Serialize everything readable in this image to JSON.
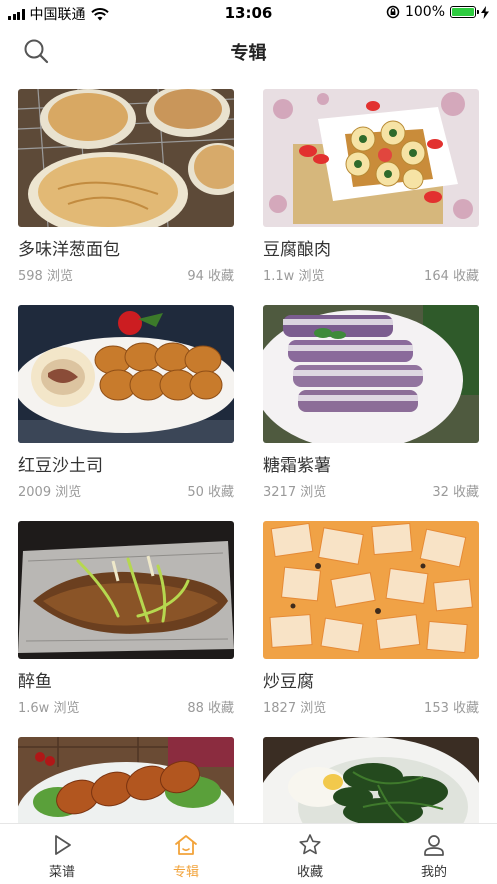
{
  "status_bar": {
    "carrier": "中国联通",
    "time": "13:06",
    "battery": "100%",
    "battery_level": 1.0
  },
  "header": {
    "title": "专辑"
  },
  "albums": [
    {
      "title": "多味洋葱面包",
      "views": "598 浏览",
      "favorites": "94 收藏"
    },
    {
      "title": "豆腐酿肉",
      "views": "1.1w 浏览",
      "favorites": "164 收藏"
    },
    {
      "title": "红豆沙土司",
      "views": "2009 浏览",
      "favorites": "50 收藏"
    },
    {
      "title": "糖霜紫薯",
      "views": "3217 浏览",
      "favorites": "32 收藏"
    },
    {
      "title": "醉鱼",
      "views": "1.6w 浏览",
      "favorites": "88 收藏"
    },
    {
      "title": "炒豆腐",
      "views": "1827 浏览",
      "favorites": "153 收藏"
    },
    {
      "title": "",
      "views": "",
      "favorites": ""
    },
    {
      "title": "",
      "views": "",
      "favorites": ""
    }
  ],
  "tabs": [
    {
      "label": "菜谱",
      "icon": "play-icon"
    },
    {
      "label": "专辑",
      "icon": "home-icon",
      "active": true
    },
    {
      "label": "收藏",
      "icon": "star-icon"
    },
    {
      "label": "我的",
      "icon": "person-icon"
    }
  ],
  "colors": {
    "accent": "#f2a33a",
    "battery": "#2ecc40"
  }
}
